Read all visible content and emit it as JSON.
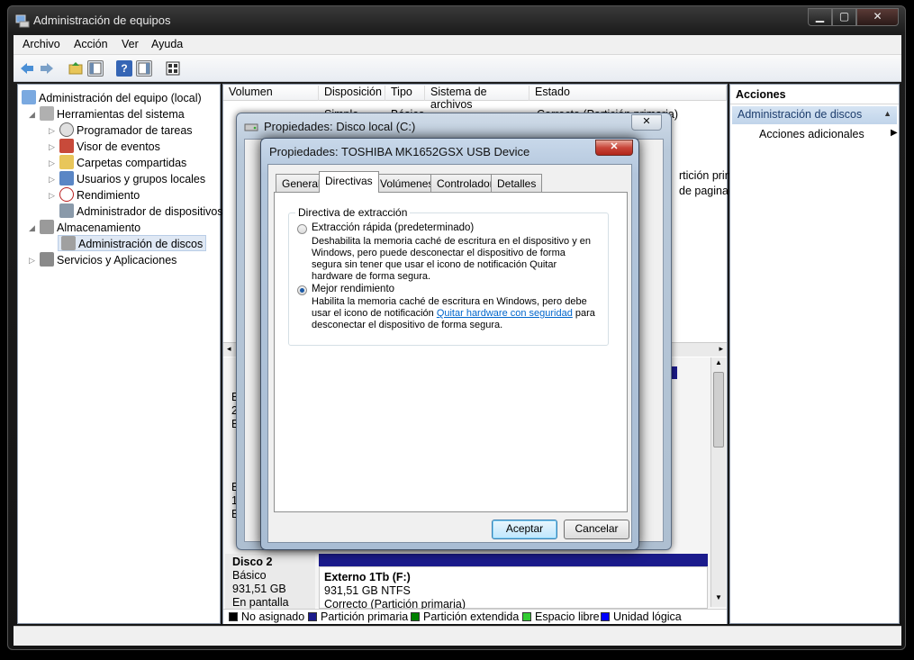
{
  "window": {
    "title": "Administración de equipos"
  },
  "menu": [
    "Archivo",
    "Acción",
    "Ver",
    "Ayuda"
  ],
  "tree": {
    "root": "Administración del equipo (local)",
    "system_tools": "Herramientas del sistema",
    "task_scheduler": "Programador de tareas",
    "event_viewer": "Visor de eventos",
    "shared_folders": "Carpetas compartidas",
    "local_users": "Usuarios y grupos locales",
    "performance": "Rendimiento",
    "device_manager": "Administrador de dispositivos",
    "storage": "Almacenamiento",
    "disk_management": "Administración de discos",
    "services": "Servicios y Aplicaciones"
  },
  "volume_table": {
    "columns": [
      "Volumen",
      "Disposición",
      "Tipo",
      "Sistema de archivos",
      "Estado"
    ],
    "row1": {
      "layout": "Simple",
      "type": "Básico",
      "status": "Correcto (Partición primaria)"
    },
    "partial_text_1": "rtición prin",
    "partial_text_2": "de paginac"
  },
  "disks": {
    "partial_lines_a": [
      "B",
      "2",
      "E"
    ],
    "partial_lines_b": [
      "B",
      "1",
      "E"
    ],
    "disk2": {
      "name": "Disco 2",
      "type": "Básico",
      "size": "931,51 GB",
      "state": "En pantalla"
    },
    "partition": {
      "name": "Externo 1Tb  (F:)",
      "size": "931,51 GB NTFS",
      "status": "Correcto (Partición primaria)"
    }
  },
  "legend": [
    {
      "label": "No asignado",
      "color": "#000000"
    },
    {
      "label": "Partición primaria",
      "color": "#1b1b8c"
    },
    {
      "label": "Partición extendida",
      "color": "#008000"
    },
    {
      "label": "Espacio libre",
      "color": "#33cc33"
    },
    {
      "label": "Unidad lógica",
      "color": "#0000ff"
    }
  ],
  "actions": {
    "title": "Acciones",
    "section": "Administración de discos",
    "more": "Acciones adicionales"
  },
  "dialog_back": {
    "title": "Propiedades: Disco local (C:)"
  },
  "dialog": {
    "title": "Propiedades: TOSHIBA MK1652GSX USB Device",
    "tabs": [
      "General",
      "Directivas",
      "Volúmenes",
      "Controlador",
      "Detalles"
    ],
    "active_tab": "Directivas",
    "group_title": "Directiva de extracción",
    "option1": {
      "label": "Extracción rápida (predeterminado)",
      "selected": false,
      "description": "Deshabilita la memoria caché de escritura en el dispositivo y en Windows, pero puede desconectar el dispositivo de forma segura sin tener que usar el icono de notificación Quitar hardware de forma segura."
    },
    "option2": {
      "label": "Mejor rendimiento",
      "selected": true,
      "description": "Habilita la memoria caché de escritura en Windows, pero debe usar el icono de notificación",
      "link": "Quitar hardware con seguridad",
      "description_after_link": " para desconectar el dispositivo de forma segura."
    },
    "ok": "Aceptar",
    "cancel": "Cancelar"
  }
}
